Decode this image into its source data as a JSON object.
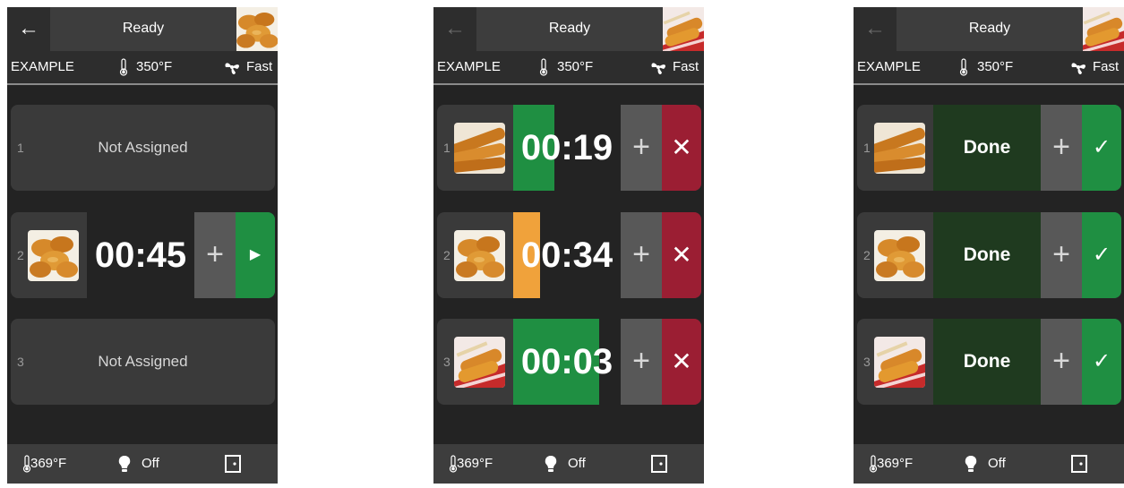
{
  "screens": [
    {
      "title": "Ready",
      "back_icon": "arrow-left-icon",
      "back_enabled": true,
      "info": {
        "name": "EXAMPLE",
        "temp": "350°F",
        "fan": "Fast"
      },
      "slots": [
        {
          "num": "1",
          "label": "Not Assigned"
        },
        {
          "num": "2",
          "timer": "00:45",
          "action_icon": "play-icon"
        },
        {
          "num": "3",
          "label": "Not Assigned"
        }
      ],
      "footer": {
        "temp": "369°F",
        "light": "Off"
      }
    },
    {
      "title": "Ready",
      "back_icon": "arrow-left-icon",
      "back_enabled": false,
      "info": {
        "name": "EXAMPLE",
        "temp": "350°F",
        "fan": "Fast"
      },
      "slots": [
        {
          "num": "1",
          "timer": "00:19",
          "progress": 0.38,
          "progress_color": "#1f8f42",
          "action_icon": "close-icon"
        },
        {
          "num": "2",
          "timer": "00:34",
          "progress": 0.25,
          "progress_color": "#f0a23b",
          "action_icon": "close-icon"
        },
        {
          "num": "3",
          "timer": "00:03",
          "progress": 0.8,
          "progress_color": "#1f8f42",
          "action_icon": "close-icon"
        }
      ],
      "footer": {
        "temp": "369°F",
        "light": "Off"
      }
    },
    {
      "title": "Ready",
      "back_icon": "arrow-left-icon",
      "back_enabled": false,
      "info": {
        "name": "EXAMPLE",
        "temp": "350°F",
        "fan": "Fast"
      },
      "slots": [
        {
          "num": "1",
          "status": "Done",
          "action_icon": "check-icon"
        },
        {
          "num": "2",
          "status": "Done",
          "action_icon": "check-icon"
        },
        {
          "num": "3",
          "status": "Done",
          "action_icon": "check-icon"
        }
      ],
      "footer": {
        "temp": "369°F",
        "light": "Off"
      }
    }
  ],
  "colors": {
    "green": "#1f8f42",
    "orange": "#f0a23b",
    "red": "#9b1e33",
    "done_bg": "#1f3a1f"
  },
  "glyphs": {
    "back": "←",
    "plus": "+",
    "play": "▶",
    "close": "✕",
    "check": "✓"
  }
}
